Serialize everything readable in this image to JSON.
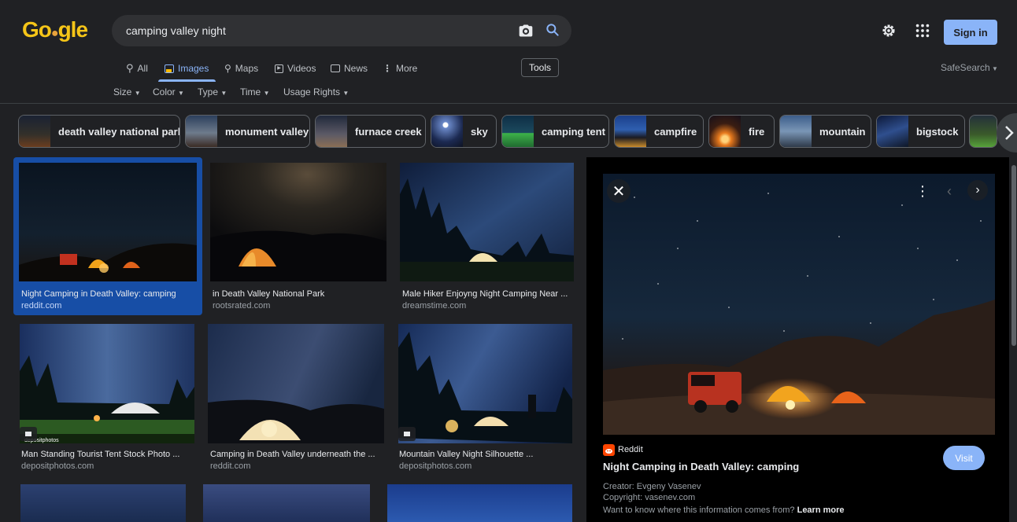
{
  "search": {
    "query": "camping valley night"
  },
  "header": {
    "logo_letters": [
      "G",
      "o",
      "o",
      "g",
      "l",
      "e"
    ],
    "sign_in": "Sign in"
  },
  "tabs": [
    {
      "label": "All",
      "icon": "search-icon"
    },
    {
      "label": "Images",
      "icon": "image-icon"
    },
    {
      "label": "Maps",
      "icon": "map-pin-icon"
    },
    {
      "label": "Videos",
      "icon": "video-icon"
    },
    {
      "label": "News",
      "icon": "news-icon"
    },
    {
      "label": "More",
      "icon": "more-vert-icon"
    }
  ],
  "tools_label": "Tools",
  "safesearch_label": "SafeSearch",
  "filters": [
    "Size",
    "Color",
    "Type",
    "Time",
    "Usage Rights"
  ],
  "chips": [
    "death valley national park",
    "monument valley",
    "furnace creek",
    "sky",
    "camping tent",
    "campfire",
    "fire",
    "mountain",
    "bigstock"
  ],
  "results": [
    {
      "title": "Night Camping in Death Valley: camping",
      "domain": "reddit.com"
    },
    {
      "title": "in Death Valley National Park",
      "domain": "rootsrated.com"
    },
    {
      "title": "Male Hiker Enjoyng Night Camping Near ...",
      "domain": "dreamstime.com"
    },
    {
      "title": "Man Standing Tourist Tent Stock Photo ...",
      "domain": "depositphotos.com"
    },
    {
      "title": "Camping in Death Valley underneath the ...",
      "domain": "reddit.com"
    },
    {
      "title": "Mountain Valley Night Silhouette ...",
      "domain": "depositphotos.com"
    }
  ],
  "watermark_text": "depositphotos",
  "preview": {
    "source": "Reddit",
    "title": "Night Camping in Death Valley: camping",
    "visit": "Visit",
    "creator": "Creator: Evgeny Vasenev",
    "copyright": "Copyright: vasenev.com",
    "info": "Want to know where this information comes from?",
    "learn_more": "Learn more"
  },
  "colors": {
    "background": "#202124",
    "accent": "#8ab4f8",
    "selected": "#174ea6",
    "reddit": "#ff4500"
  }
}
